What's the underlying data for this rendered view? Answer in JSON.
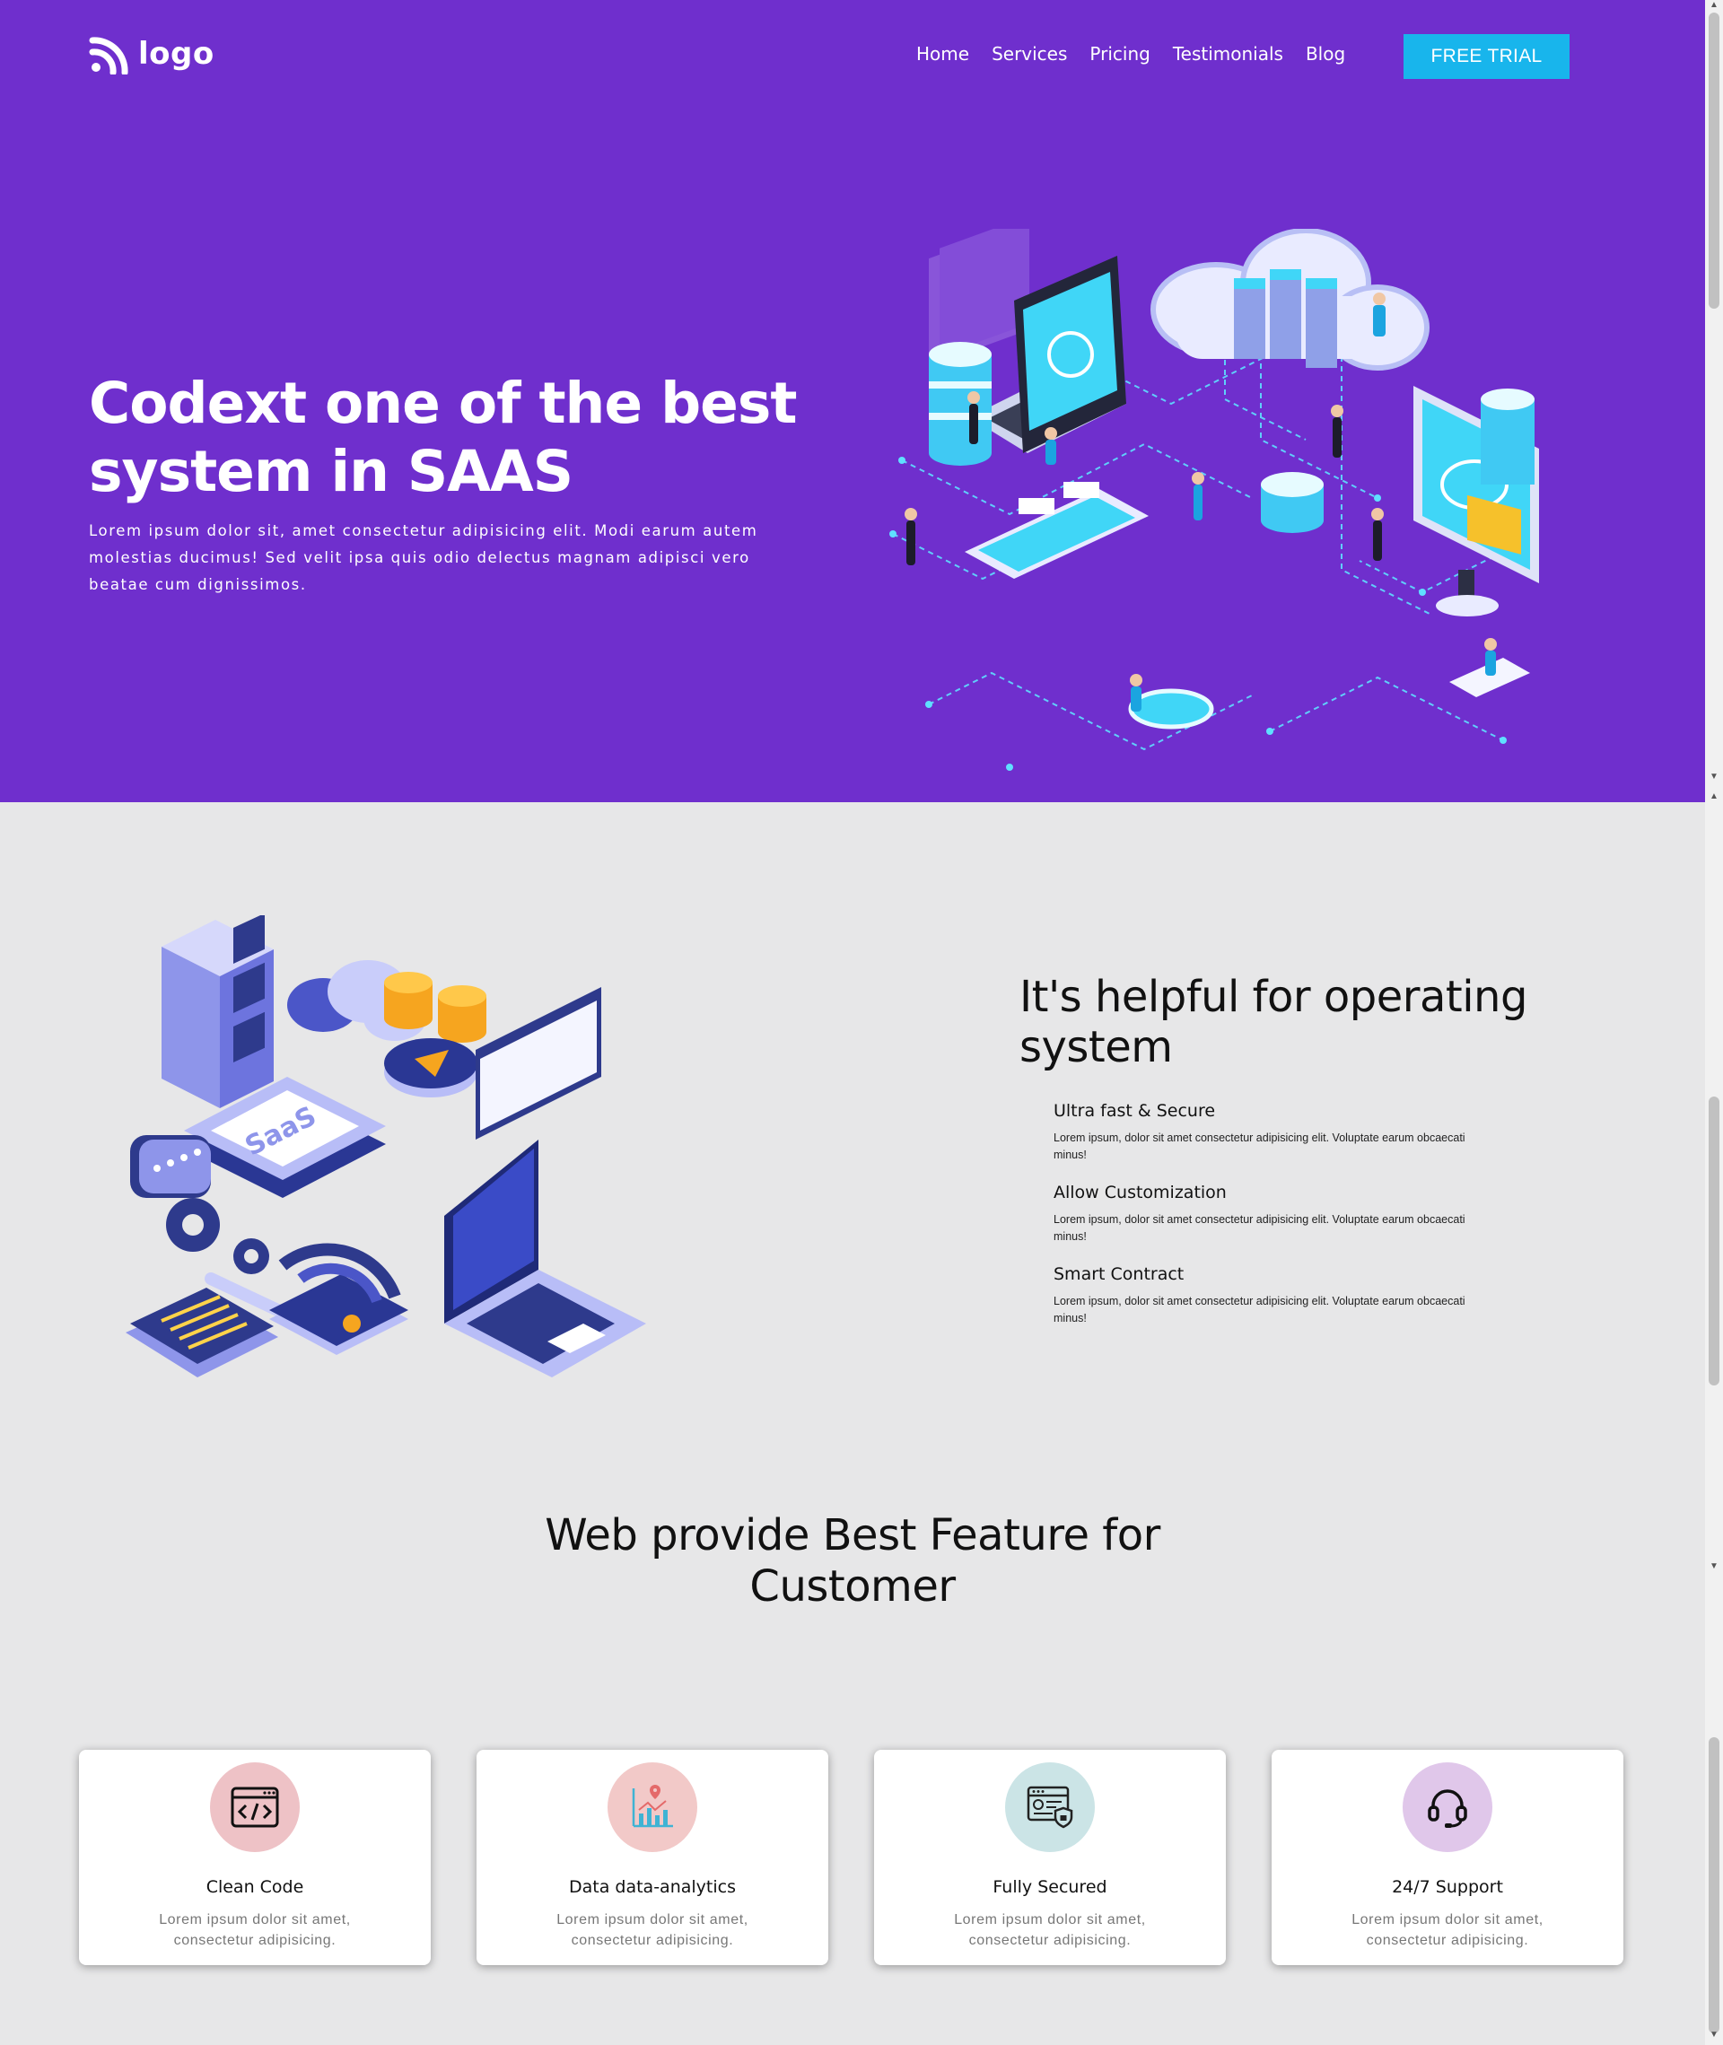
{
  "header": {
    "logo_text": "logo",
    "nav": [
      "Home",
      "Services",
      "Pricing",
      "Testimonials",
      "Blog"
    ],
    "cta_label": "FREE TRIAL"
  },
  "hero": {
    "title": "Codext one of the best system in SAAS",
    "description": "Lorem ipsum dolor sit, amet consectetur adipisicing elit. Modi earum autem molestias ducimus! Sed velit ipsa quis odio delectus magnam adipisci vero beatae cum dignissimos.",
    "illustration": "isometric-cloud-network-illustration"
  },
  "operating": {
    "title": "It's helpful for operating system",
    "illustration": "isometric-saas-illustration",
    "illustration_label": "SaaS",
    "features": [
      {
        "title": "Ultra fast & Secure",
        "text": "Lorem ipsum, dolor sit amet consectetur adipisicing elit. Voluptate earum obcaecati minus!"
      },
      {
        "title": "Allow Customization",
        "text": "Lorem ipsum, dolor sit amet consectetur adipisicing elit. Voluptate earum obcaecati minus!"
      },
      {
        "title": "Smart Contract",
        "text": "Lorem ipsum, dolor sit amet consectetur adipisicing elit. Voluptate earum obcaecati minus!"
      }
    ]
  },
  "features_section": {
    "title": "Web provide Best Feature for Customer",
    "cards": [
      {
        "title": "Clean Code",
        "text": "Lorem ipsum dolor sit amet, consectetur adipisicing.",
        "icon": "code-window-icon",
        "icon_bg": "#eec2c6"
      },
      {
        "title": "Data data-analytics",
        "text": "Lorem ipsum dolor sit amet, consectetur adipisicing.",
        "icon": "analytics-chart-icon",
        "icon_bg": "#f2c9c8"
      },
      {
        "title": "Fully Secured",
        "text": "Lorem ipsum dolor sit amet, consectetur adipisicing.",
        "icon": "secure-document-icon",
        "icon_bg": "#cbe4e6"
      },
      {
        "title": "24/7 Support",
        "text": "Lorem ipsum dolor sit amet, consectetur adipisicing.",
        "icon": "headset-icon",
        "icon_bg": "#e0c7ea"
      }
    ]
  },
  "colors": {
    "hero_bg": "#6f2fcd",
    "cta_bg": "#18b5ec",
    "page_bg": "#e7e7e8"
  }
}
